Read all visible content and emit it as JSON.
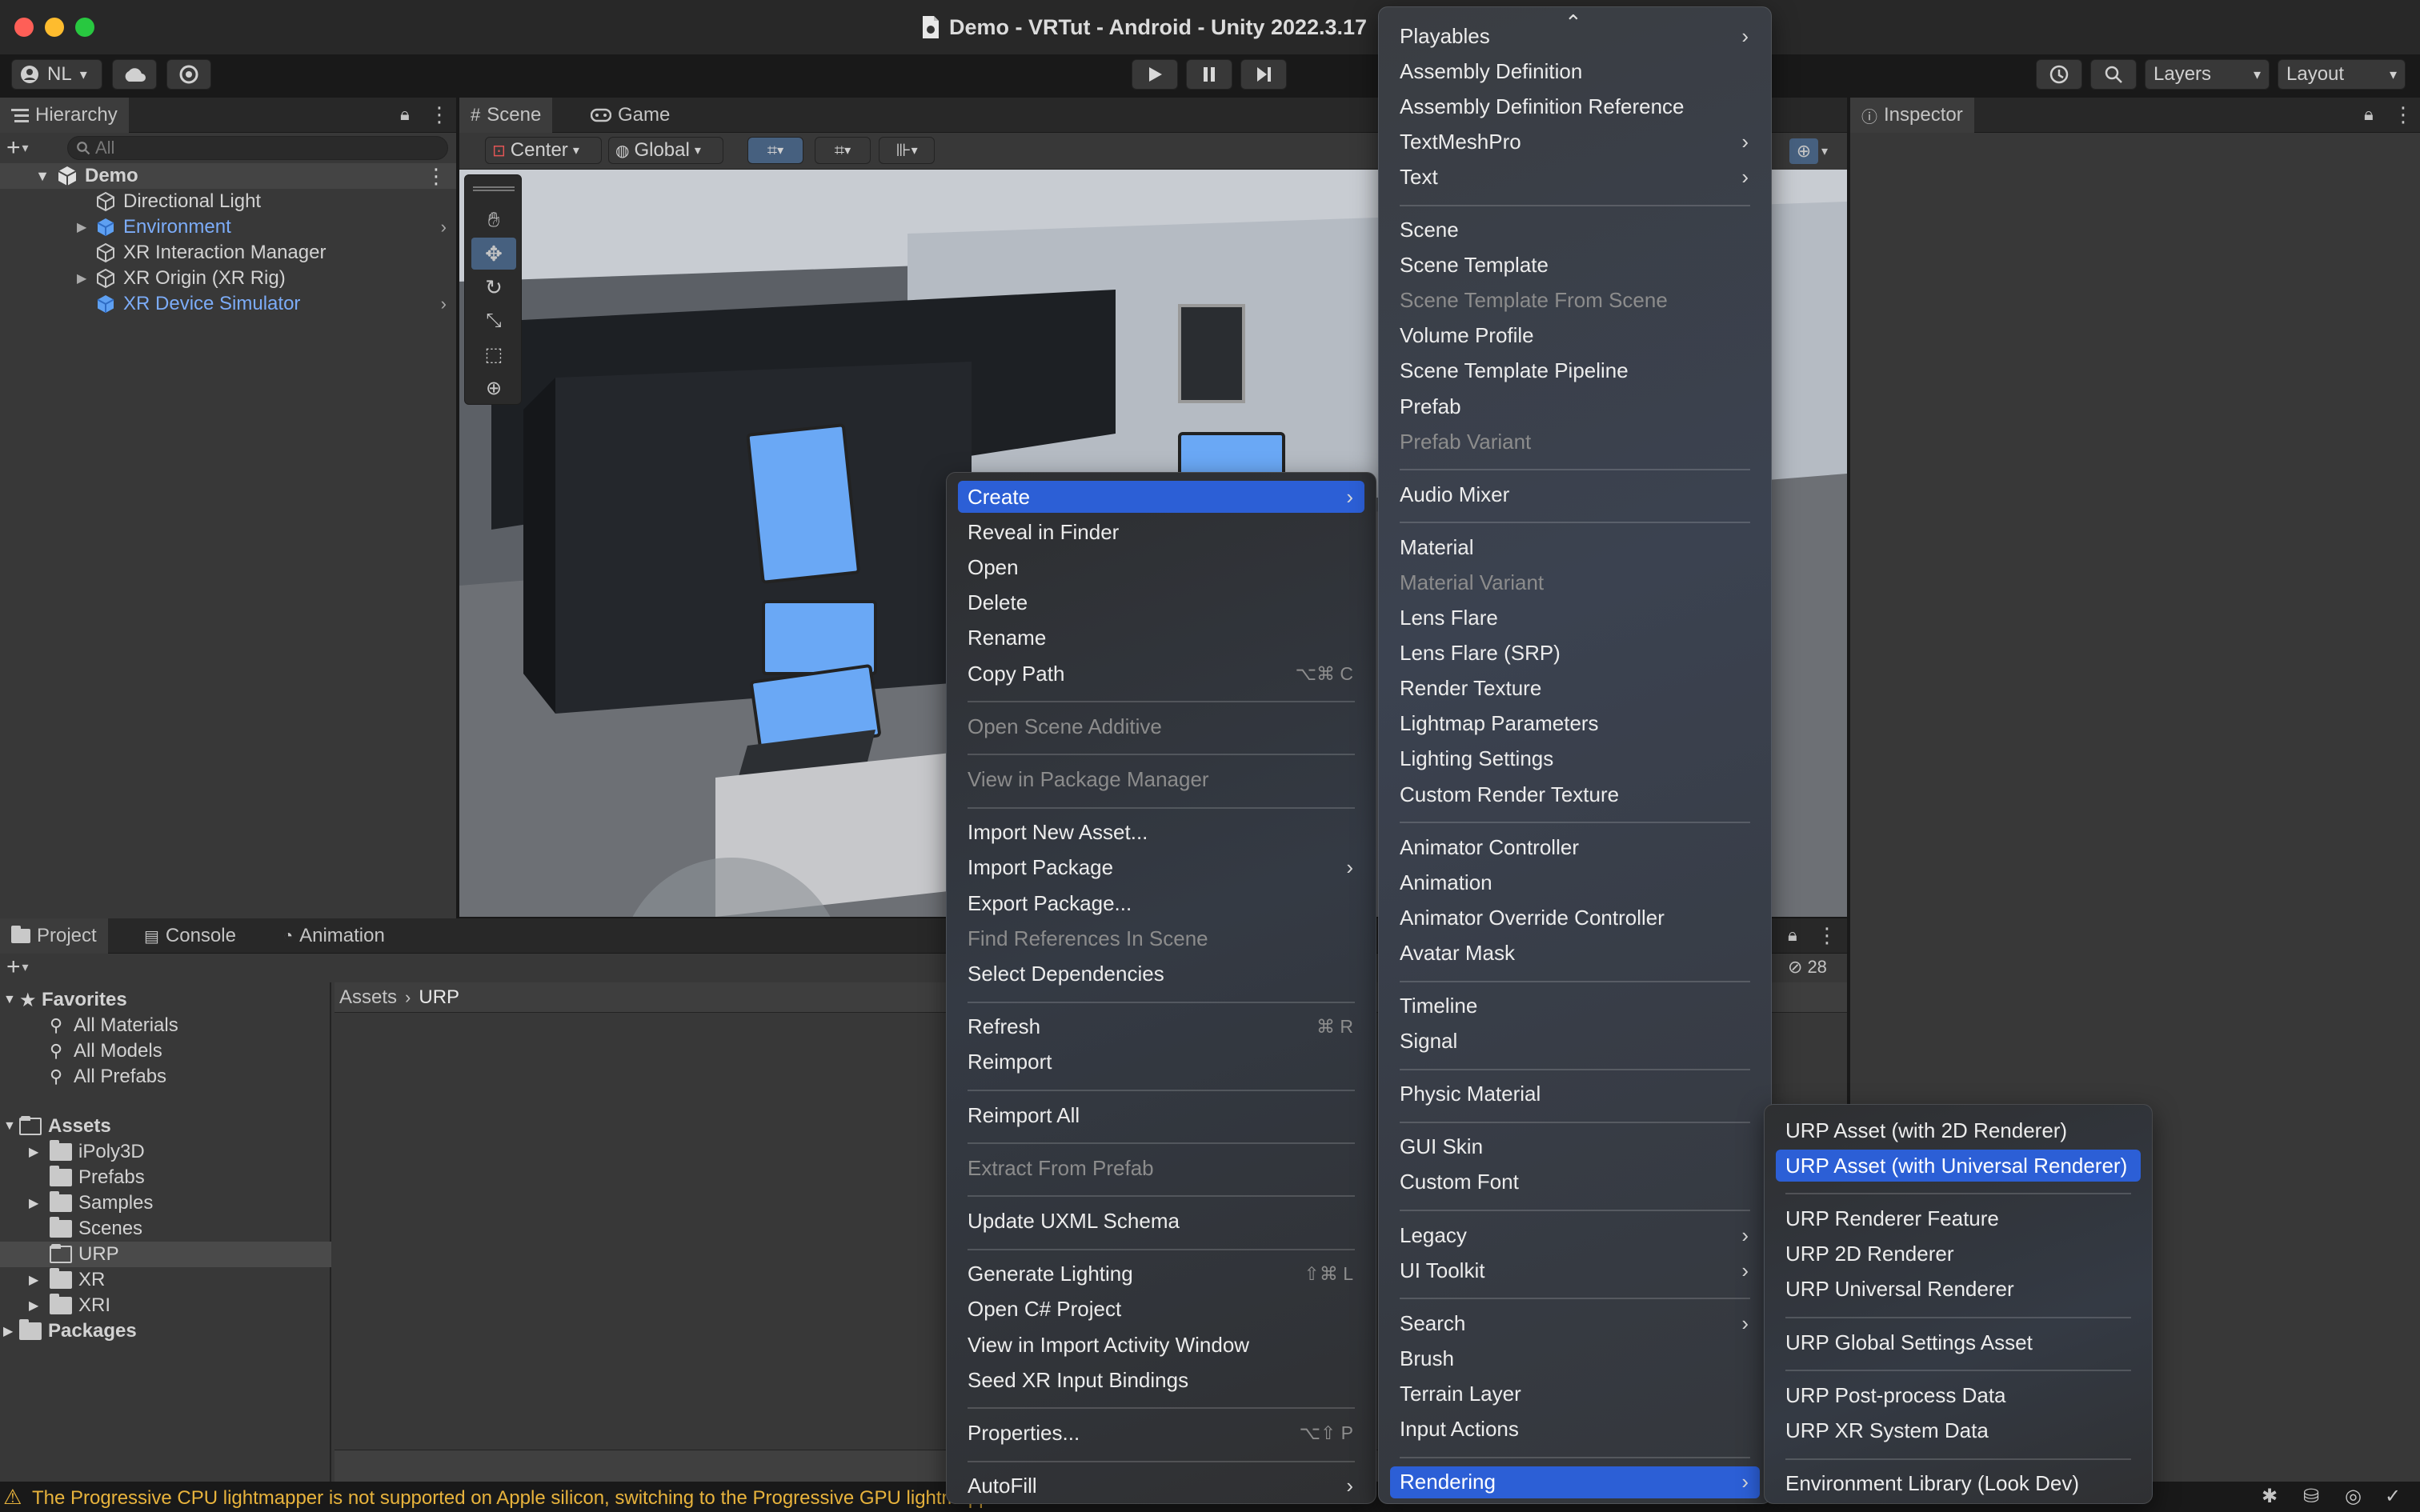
{
  "window": {
    "title": "Demo - VRTut - Android - Unity 2022.3.17"
  },
  "toolbar": {
    "account": "NL",
    "layers": "Layers",
    "layout": "Layout"
  },
  "hierarchy": {
    "tab": "Hierarchy",
    "search_placeholder": "All",
    "scene": "Demo",
    "items": [
      "Directional Light",
      "Environment",
      "XR Interaction Manager",
      "XR Origin (XR Rig)",
      "XR Device Simulator"
    ]
  },
  "scene_view": {
    "tabs": [
      "Scene",
      "Game"
    ],
    "pivot": "Center",
    "space": "Global"
  },
  "inspector": {
    "tab": "Inspector"
  },
  "project": {
    "tabs": [
      "Project",
      "Console",
      "Animation"
    ],
    "breadcrumb": [
      "Assets",
      "URP"
    ],
    "hidden_count": "28",
    "favorites": {
      "label": "Favorites",
      "items": [
        "All Materials",
        "All Models",
        "All Prefabs"
      ]
    },
    "assets": {
      "label": "Assets",
      "items": [
        "iPoly3D",
        "Prefabs",
        "Samples",
        "Scenes",
        "URP",
        "XR",
        "XRI"
      ]
    },
    "packages": "Packages"
  },
  "context_menu": {
    "items": [
      {
        "label": "Create",
        "submenu": true,
        "selected": true
      },
      {
        "label": "Reveal in Finder"
      },
      {
        "label": "Open"
      },
      {
        "label": "Delete"
      },
      {
        "label": "Rename"
      },
      {
        "label": "Copy Path",
        "shortcut": "⌥⌘ C"
      },
      {
        "sep": true
      },
      {
        "label": "Open Scene Additive",
        "disabled": true
      },
      {
        "sep": true
      },
      {
        "label": "View in Package Manager",
        "disabled": true
      },
      {
        "sep": true
      },
      {
        "label": "Import New Asset..."
      },
      {
        "label": "Import Package",
        "submenu": true
      },
      {
        "label": "Export Package..."
      },
      {
        "label": "Find References In Scene",
        "disabled": true
      },
      {
        "label": "Select Dependencies"
      },
      {
        "sep": true
      },
      {
        "label": "Refresh",
        "shortcut": "⌘ R"
      },
      {
        "label": "Reimport"
      },
      {
        "sep": true
      },
      {
        "label": "Reimport All"
      },
      {
        "sep": true
      },
      {
        "label": "Extract From Prefab",
        "disabled": true
      },
      {
        "sep": true
      },
      {
        "label": "Update UXML Schema"
      },
      {
        "sep": true
      },
      {
        "label": "Generate Lighting",
        "shortcut": "⇧⌘ L"
      },
      {
        "label": "Open C# Project"
      },
      {
        "label": "View in Import Activity Window"
      },
      {
        "label": "Seed XR Input Bindings"
      },
      {
        "sep": true
      },
      {
        "label": "Properties...",
        "shortcut": "⌥⇧ P"
      },
      {
        "sep": true
      },
      {
        "label": "AutoFill",
        "submenu": true
      }
    ]
  },
  "create_menu": {
    "items": [
      {
        "label": "Playables",
        "submenu": true
      },
      {
        "label": "Assembly Definition"
      },
      {
        "label": "Assembly Definition Reference"
      },
      {
        "label": "TextMeshPro",
        "submenu": true
      },
      {
        "label": "Text",
        "submenu": true
      },
      {
        "sep": true
      },
      {
        "label": "Scene"
      },
      {
        "label": "Scene Template"
      },
      {
        "label": "Scene Template From Scene",
        "disabled": true
      },
      {
        "label": "Volume Profile"
      },
      {
        "label": "Scene Template Pipeline"
      },
      {
        "label": "Prefab"
      },
      {
        "label": "Prefab Variant",
        "disabled": true
      },
      {
        "sep": true
      },
      {
        "label": "Audio Mixer"
      },
      {
        "sep": true
      },
      {
        "label": "Material"
      },
      {
        "label": "Material Variant",
        "disabled": true
      },
      {
        "label": "Lens Flare"
      },
      {
        "label": "Lens Flare (SRP)"
      },
      {
        "label": "Render Texture"
      },
      {
        "label": "Lightmap Parameters"
      },
      {
        "label": "Lighting Settings"
      },
      {
        "label": "Custom Render Texture"
      },
      {
        "sep": true
      },
      {
        "label": "Animator Controller"
      },
      {
        "label": "Animation"
      },
      {
        "label": "Animator Override Controller"
      },
      {
        "label": "Avatar Mask"
      },
      {
        "sep": true
      },
      {
        "label": "Timeline"
      },
      {
        "label": "Signal"
      },
      {
        "sep": true
      },
      {
        "label": "Physic Material"
      },
      {
        "sep": true
      },
      {
        "label": "GUI Skin"
      },
      {
        "label": "Custom Font"
      },
      {
        "sep": true
      },
      {
        "label": "Legacy",
        "submenu": true
      },
      {
        "label": "UI Toolkit",
        "submenu": true
      },
      {
        "sep": true
      },
      {
        "label": "Search",
        "submenu": true
      },
      {
        "label": "Brush"
      },
      {
        "label": "Terrain Layer"
      },
      {
        "label": "Input Actions"
      },
      {
        "sep": true
      },
      {
        "label": "Rendering",
        "submenu": true,
        "selected": true
      }
    ]
  },
  "rendering_menu": {
    "items": [
      {
        "label": "URP Asset (with 2D Renderer)"
      },
      {
        "label": "URP Asset (with Universal Renderer)",
        "selected": true
      },
      {
        "sep": true
      },
      {
        "label": "URP Renderer Feature"
      },
      {
        "label": "URP 2D Renderer"
      },
      {
        "label": "URP Universal Renderer"
      },
      {
        "sep": true
      },
      {
        "label": "URP Global Settings Asset"
      },
      {
        "sep": true
      },
      {
        "label": "URP Post-process Data"
      },
      {
        "label": "URP XR System Data"
      },
      {
        "sep": true
      },
      {
        "label": "Environment Library (Look Dev)"
      }
    ]
  },
  "status": {
    "message": "The Progressive CPU lightmapper is not supported on Apple silicon, switching to the Progressive GPU lightmapper"
  },
  "colors": {
    "selection": "#2c5fd6",
    "prefab_blue": "#7cacf8",
    "warning": "#e8b33c"
  }
}
